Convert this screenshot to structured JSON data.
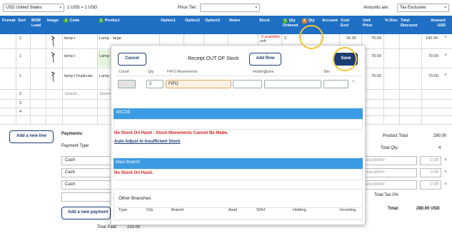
{
  "topbar": {
    "currency": "USD United States",
    "rate": "1 USD = 1 USD",
    "price_tier_label": "Price Tier:",
    "amounts_label": "Amounts are:",
    "amounts_value": "Tax Exclusive"
  },
  "columns": {
    "format": "Format",
    "sort": "Sort",
    "bom": "BOM Load",
    "image": "Image",
    "code": "Code",
    "code_badge": "1",
    "product": "Product",
    "product_badge": "1",
    "option1": "Option1",
    "option2": "Option2",
    "option3": "Option3",
    "notes": "Notes",
    "stock": "Stock",
    "qty_ordered": "Qty Ordered",
    "qty_ordered_badge": "1",
    "qty_received": "Qty",
    "qty_received_badge": "2",
    "account": "Account",
    "cost": "Cost Excl",
    "unit_price": "Unit Price",
    "disc": "% Disc",
    "total_discount": "Total Discount",
    "amount": "Amount USD"
  },
  "rows": [
    {
      "sort": "1",
      "code": "lamp-l",
      "product": "Lamp - large",
      "stock": "-2 available",
      "stock2": "soh",
      "qty_ordered": "2",
      "cost": "30.00",
      "unit_price": "70.00",
      "amount": "140.00"
    },
    {
      "sort": "1",
      "code": "lamp-l",
      "product": "Lamp - l",
      "unit_price": "70.00",
      "amount": "70.00"
    },
    {
      "sort": "1",
      "code": "lamp-l-Duplicate",
      "product": "Lamp - l",
      "unit_price": "70.00",
      "amount": "70.00"
    },
    {
      "sort": "2",
      "code_placeholder": "Search...",
      "product_placeholder": "Search..."
    },
    {
      "sort": "3"
    },
    {
      "sort": "4"
    }
  ],
  "left_panel": {
    "add_line": "Add a new line",
    "payments_label": "Payments:",
    "payment_type_label": "Payment Type",
    "payments": [
      "Cash",
      "Cash",
      "Cash"
    ],
    "add_payment": "Add a new payment",
    "total_paid_label": "Total Paid:",
    "total_paid_value": "210.00"
  },
  "right_panel": {
    "product_total_label": "Product Total",
    "product_total_value": "280.00",
    "total_qty_label": "Total Qty:",
    "total_qty_value": "4",
    "desc_placeholder": "escription",
    "desc_value": "0.00",
    "total_tax_label": "Total Tax 0%",
    "total_label": "Total:",
    "total_value": "280.00 USD"
  },
  "modal": {
    "title": "Receipt OUT OF Stock",
    "cancel": "Cancel",
    "add_row": "Add Row",
    "save": "Save",
    "col_count": "Count",
    "col_qty": "Qty",
    "col_fifo": "FIFO Movements",
    "col_holding": "Holding",
    "col_zone": "Zone",
    "col_bin": "Bin",
    "qty_value": "2",
    "fifo_value": "FIFO",
    "sections": [
      {
        "name": "ABCDE",
        "message": "No Stock On Hand - Stock Movements Cannot Be Made.",
        "link": "Auto Adjust In Insufficient Stock"
      },
      {
        "name": "Main Branch",
        "message": "No Stock On Hand."
      }
    ],
    "other_branches": "Other Branches",
    "ob_cols": {
      "type": "Type",
      "city": "City",
      "branch": "Branch",
      "avail": "Avail",
      "soh": "SOH",
      "holding": "Holding",
      "incoming": "Incoming"
    }
  },
  "colors": {
    "header_blue": "#1f6fc4",
    "banner_blue": "#3b9be3",
    "navy": "#1d3b73",
    "highlight": "#f4c430"
  }
}
